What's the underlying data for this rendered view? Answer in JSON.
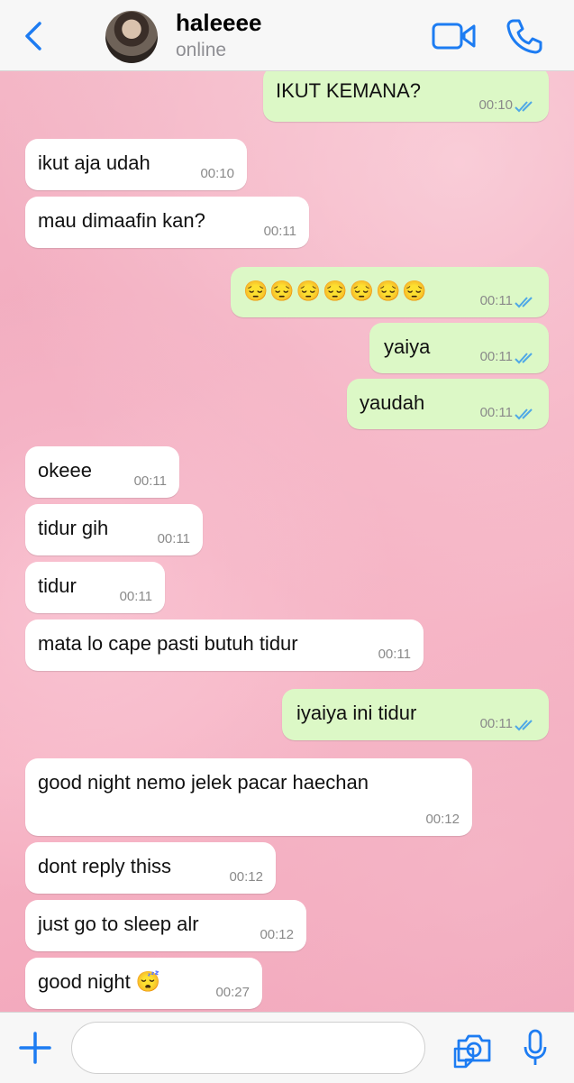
{
  "header": {
    "contact_name": "haleeee",
    "status": "online"
  },
  "messages": [
    {
      "dir": "out",
      "text": "IKUT KEMANA?",
      "time": "00:10"
    },
    {
      "dir": "in",
      "text": "ikut aja udah",
      "time": "00:10"
    },
    {
      "dir": "in",
      "text": "mau dimaafin kan?",
      "time": "00:11"
    },
    {
      "dir": "out",
      "text": "😔😔😔😔😔😔😔",
      "time": "00:11"
    },
    {
      "dir": "out",
      "text": "yaiya",
      "time": "00:11"
    },
    {
      "dir": "out",
      "text": "yaudah",
      "time": "00:11"
    },
    {
      "dir": "in",
      "text": "okeee",
      "time": "00:11"
    },
    {
      "dir": "in",
      "text": "tidur gih",
      "time": "00:11"
    },
    {
      "dir": "in",
      "text": "tidur",
      "time": "00:11"
    },
    {
      "dir": "in",
      "text": "mata lo cape pasti butuh tidur",
      "time": "00:11"
    },
    {
      "dir": "out",
      "text": "iyaiya ini tidur",
      "time": "00:11"
    },
    {
      "dir": "in",
      "text": "good night nemo jelek pacar haechan",
      "time": "00:12"
    },
    {
      "dir": "in",
      "text": "dont reply thiss",
      "time": "00:12"
    },
    {
      "dir": "in",
      "text": "just go to sleep alr",
      "time": "00:12"
    },
    {
      "dir": "in",
      "text": "good night 😴",
      "time": "00:27"
    }
  ],
  "colors": {
    "accent": "#1d7cf2",
    "outgoing_bubble": "#dcf8c6",
    "incoming_bubble": "#ffffff",
    "read_ticks": "#4fa8e6"
  },
  "icons": [
    "back-chevron-icon",
    "video-call-icon",
    "phone-icon",
    "plus-icon",
    "sticker-icon",
    "camera-icon",
    "microphone-icon",
    "read-ticks-icon"
  ]
}
